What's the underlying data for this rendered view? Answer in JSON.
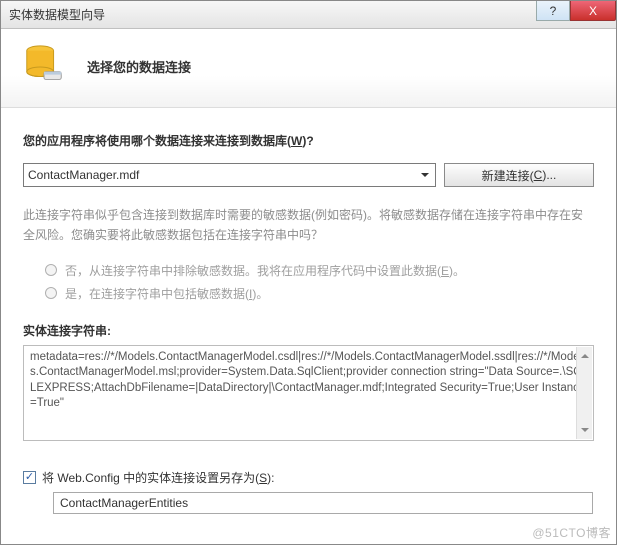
{
  "window": {
    "title": "实体数据模型向导",
    "help_glyph": "?",
    "close_glyph": "X"
  },
  "header": {
    "title": "选择您的数据连接"
  },
  "main": {
    "question_prefix": "您的应用程序将使用哪个数据连接来连接到数据库(",
    "question_key": "W",
    "question_suffix": ")?",
    "selected_connection": "ContactManager.mdf",
    "new_connection_prefix": "新建连接(",
    "new_connection_key": "C",
    "new_connection_suffix": ")...",
    "hint": "此连接字符串似乎包含连接到数据库时需要的敏感数据(例如密码)。将敏感数据存储在连接字符串中存在安全风险。您确实要将此敏感数据包括在连接字符串中吗？",
    "radio_no_prefix": "否，从连接字符串中排除敏感数据。我将在应用程序代码中设置此数据(",
    "radio_no_key": "E",
    "radio_no_suffix": ")。",
    "radio_yes_prefix": "是，在连接字符串中包括敏感数据(",
    "radio_yes_key": "I",
    "radio_yes_suffix": ")。",
    "cs_label": "实体连接字符串:",
    "connection_string": "metadata=res://*/Models.ContactManagerModel.csdl|res://*/Models.ContactManagerModel.ssdl|res://*/Models.ContactManagerModel.msl;provider=System.Data.SqlClient;provider connection string=\"Data Source=.\\SQLEXPRESS;AttachDbFilename=|DataDirectory|\\ContactManager.mdf;Integrated Security=True;User Instance=True\"",
    "save_prefix": "将 Web.Config 中的实体连接设置另存为(",
    "save_key": "S",
    "save_suffix": "):",
    "save_value": "ContactManagerEntities"
  },
  "watermark": "@51CTO博客"
}
